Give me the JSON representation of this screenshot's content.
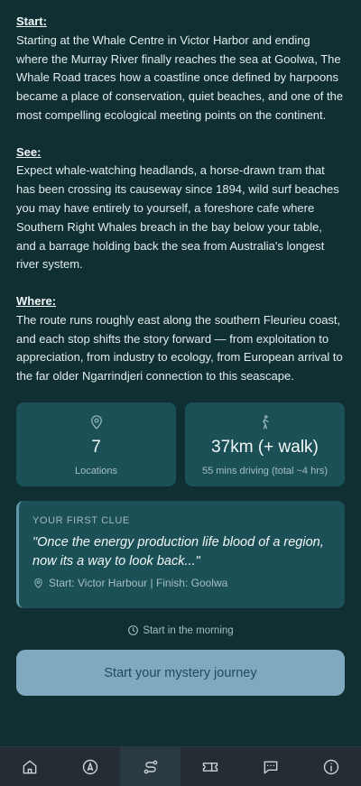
{
  "sections": [
    {
      "heading": "Start:",
      "body": "Starting at the Whale Centre in Victor Harbor and ending where the Murray River finally reaches the sea at Goolwa, The Whale Road traces how a coastline once defined by harpoons became a place of conservation, quiet beaches, and one of the most compelling ecological meeting points on the continent."
    },
    {
      "heading": "See:",
      "body": "Expect whale-watching headlands, a horse-drawn tram that has been crossing its causeway since 1894, wild surf beaches you may have entirely to yourself, a foreshore cafe where Southern Right Whales breach in the bay below your table, and a barrage holding back the sea from Australia's longest river system."
    },
    {
      "heading": "Where:",
      "body": "The route runs roughly east along the southern Fleurieu coast, and each stop shifts the story forward — from exploitation to appreciation, from industry to ecology, from European arrival to the far older Ngarrindjeri connection to this seascape."
    }
  ],
  "stats": {
    "locations": {
      "value": "7",
      "label": "Locations",
      "icon": "map-pin-icon"
    },
    "distance": {
      "value": "37km (+ walk)",
      "label": "55 mins driving (total ~4 hrs)",
      "icon": "walking-person-icon"
    }
  },
  "clue": {
    "title": "YOUR FIRST CLUE",
    "quote": "\"Once the energy production life blood of a region, now its a way to look back...\"",
    "meta": "Start: Victor Harbour | Finish: Goolwa"
  },
  "timing": "Start in the morning",
  "cta_label": "Start your mystery journey",
  "nav": [
    {
      "icon": "home-icon",
      "active": false
    },
    {
      "icon": "compass-icon",
      "active": false
    },
    {
      "icon": "route-icon",
      "active": true
    },
    {
      "icon": "ticket-icon",
      "active": false
    },
    {
      "icon": "chat-icon",
      "active": false
    },
    {
      "icon": "info-icon",
      "active": false
    }
  ],
  "colors": {
    "background": "#0f2f33",
    "card": "#1b5057",
    "accent": "#5e9aa8",
    "button": "#7fa9be",
    "navbar": "#242d33"
  }
}
